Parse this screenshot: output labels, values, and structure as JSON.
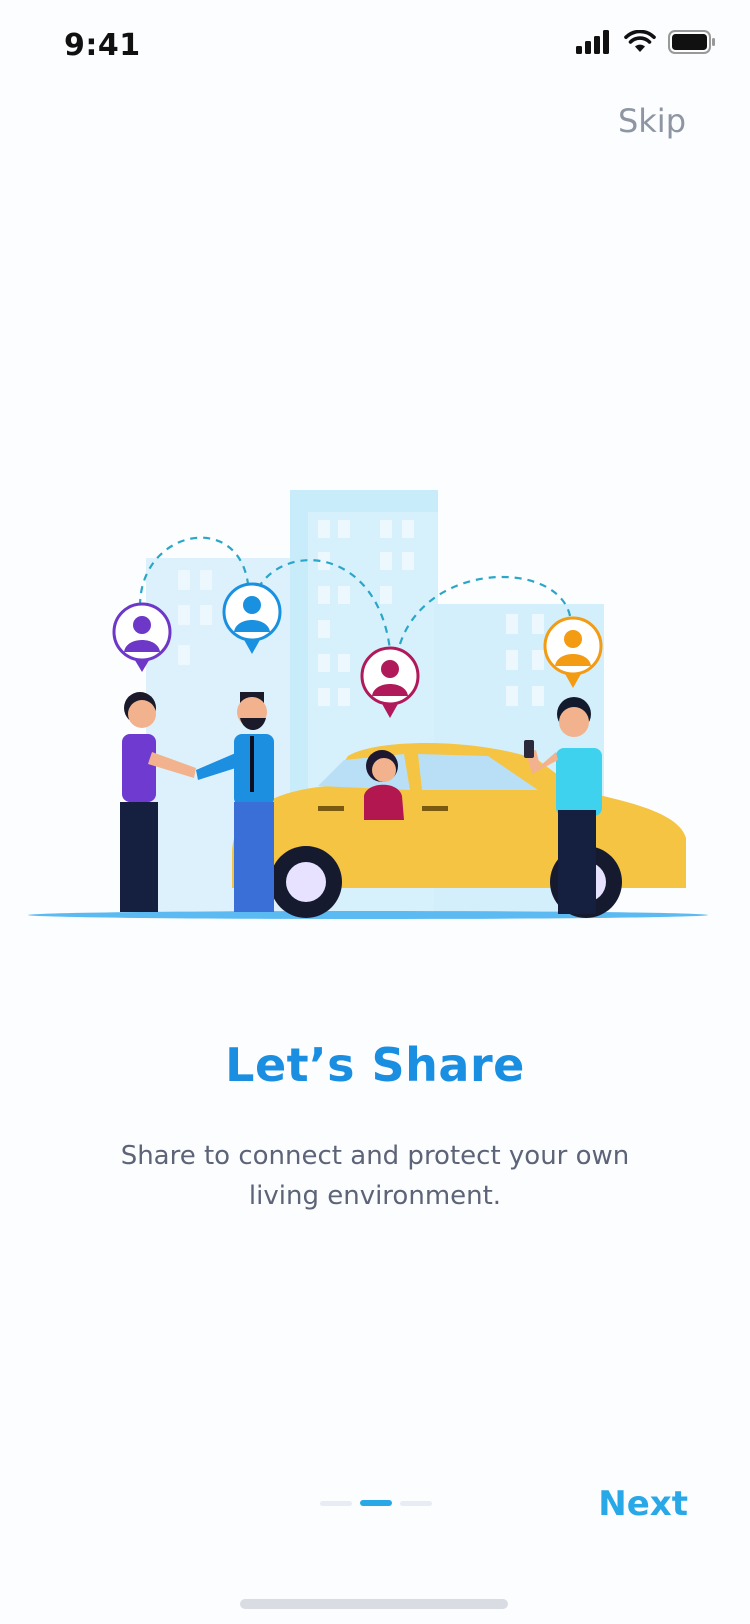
{
  "status_bar": {
    "time": "9:41",
    "icons": [
      "cellular-signal-icon",
      "wifi-icon",
      "battery-icon"
    ]
  },
  "skip_label": "Skip",
  "illustration": {
    "name": "ride-sharing-illustration"
  },
  "onboarding": {
    "title": "Let’s Share",
    "description": "Share to connect and protect your own living environment."
  },
  "pagination": {
    "total": 3,
    "active_index": 2
  },
  "next_label": "Next",
  "colors": {
    "accent": "#29a8e8",
    "title": "#1a8ee0",
    "body_text": "#5d6478",
    "skip": "#8e96a3"
  }
}
